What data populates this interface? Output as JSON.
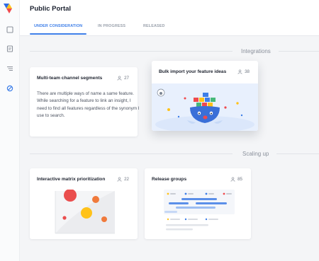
{
  "app": {
    "title": "Public Portal"
  },
  "tabs": [
    {
      "label": "UNDER CONSIDERATION",
      "active": true
    },
    {
      "label": "IN PROGRESS",
      "active": false
    },
    {
      "label": "RELEASED",
      "active": false
    }
  ],
  "sections": [
    {
      "label": "Integrations",
      "cards": [
        {
          "title": "Multi-team channel segments",
          "votes": "27",
          "description": "There are multiple ways of name a same feature. While searching for a feature to link an insight, I need to find all features regardless of the synonym I use to search."
        },
        {
          "title": "Bulk import your feature ideas",
          "votes": "38",
          "illustration": "whale-container-ship"
        }
      ]
    },
    {
      "label": "Scaling up",
      "cards": [
        {
          "title": "Interactive matrix prioritization",
          "votes": "22",
          "illustration": "bubble-matrix-chart"
        },
        {
          "title": "Release groups",
          "votes": "85",
          "illustration": "gantt-roadmap"
        }
      ]
    }
  ],
  "icons": {
    "logo": "productboard-logo-icon",
    "sidebar": [
      "square-icon",
      "document-icon",
      "list-icon",
      "portal-icon"
    ],
    "votes": "person-icon"
  },
  "colors": {
    "accent": "#3d7ee8",
    "logo_blue": "#2e6be6",
    "logo_red": "#f0494d",
    "logo_yellow": "#ffc21a"
  }
}
